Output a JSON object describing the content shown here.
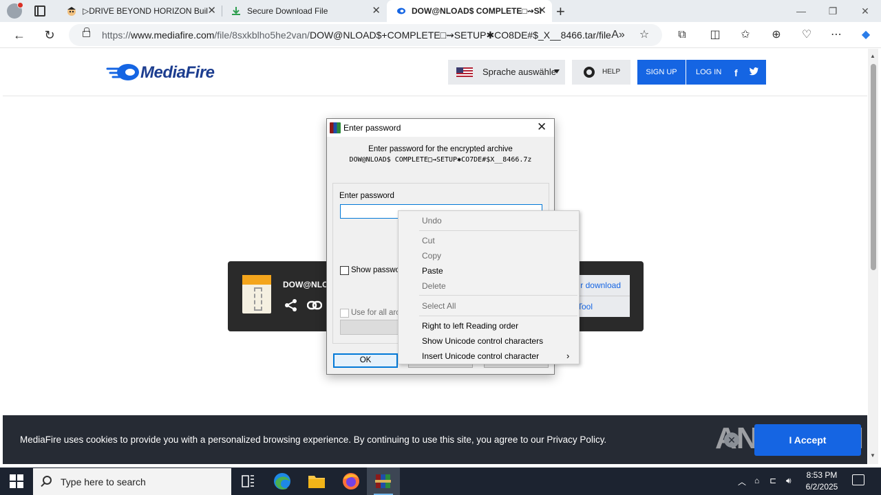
{
  "browser": {
    "tabs": [
      {
        "title": "▷DRIVE BEYOND HORIZON Buil",
        "active": false
      },
      {
        "title": "Secure Download File",
        "active": false
      },
      {
        "title": "DOW@NLOAD$ COMPLETE□⇝SI",
        "active": true
      }
    ],
    "url_prefix": "https://",
    "url_host": "www.mediafire.com",
    "url_path": "/file/8sxkblho5he2van/",
    "url_file": "DOW@NLOAD$+COMPLETE□⇝SETUP✱CO8DE#$_X__8466.tar/file"
  },
  "mediafire": {
    "logo_text": "MediaFire",
    "language_label": "Sprache auswähle",
    "help_label": "HELP",
    "signup_label": "SIGN UP",
    "login_label": "LOG IN",
    "file_name_partial": "DOW@NLO",
    "download_button_partial": "r download",
    "tool_button_partial": "Tool"
  },
  "cookie": {
    "message": "MediaFire uses cookies to provide you with a personalized browsing experience. By continuing to use this site, you agree to our Privacy Policy.",
    "accept_label": "I Accept",
    "close_symbol": "✕"
  },
  "watermark": "ANY▷RUN",
  "dialog": {
    "title": "Enter password",
    "message": "Enter password for the encrypted archive",
    "archive_name": "DOW@NLOAD$ COMPLETE□⇝SETUP✱CO7DE#$X__8466.7z",
    "password_label": "Enter password",
    "password_value": "",
    "show_password_label": "Show passwor",
    "use_for_all_label": "Use for all arch",
    "ok_label": "OK"
  },
  "context_menu": {
    "items": [
      {
        "label": "Undo",
        "enabled": false
      },
      {
        "label": "Cut",
        "enabled": false
      },
      {
        "label": "Copy",
        "enabled": false
      },
      {
        "label": "Paste",
        "enabled": true
      },
      {
        "label": "Delete",
        "enabled": false
      },
      {
        "label": "Select All",
        "enabled": false
      },
      {
        "label": "Right to left Reading order",
        "enabled": true
      },
      {
        "label": "Show Unicode control characters",
        "enabled": true
      },
      {
        "label": "Insert Unicode control character",
        "enabled": true
      }
    ]
  },
  "taskbar": {
    "search_placeholder": "Type here to search",
    "time": "8:53 PM",
    "date": "6/2/2025"
  },
  "colors": {
    "mediafire_blue": "#1565e3",
    "cookie_bg": "#262b34",
    "taskbar_bg": "#1c2330"
  }
}
